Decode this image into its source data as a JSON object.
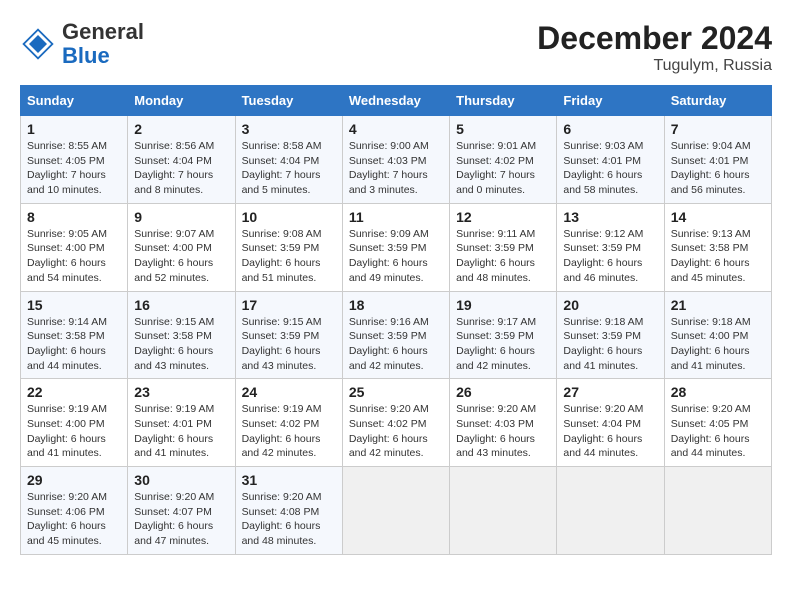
{
  "logo": {
    "text_general": "General",
    "text_blue": "Blue"
  },
  "header": {
    "title": "December 2024",
    "subtitle": "Tugulym, Russia"
  },
  "weekdays": [
    "Sunday",
    "Monday",
    "Tuesday",
    "Wednesday",
    "Thursday",
    "Friday",
    "Saturday"
  ],
  "weeks": [
    [
      {
        "day": "1",
        "info": "Sunrise: 8:55 AM\nSunset: 4:05 PM\nDaylight: 7 hours and 10 minutes."
      },
      {
        "day": "2",
        "info": "Sunrise: 8:56 AM\nSunset: 4:04 PM\nDaylight: 7 hours and 8 minutes."
      },
      {
        "day": "3",
        "info": "Sunrise: 8:58 AM\nSunset: 4:04 PM\nDaylight: 7 hours and 5 minutes."
      },
      {
        "day": "4",
        "info": "Sunrise: 9:00 AM\nSunset: 4:03 PM\nDaylight: 7 hours and 3 minutes."
      },
      {
        "day": "5",
        "info": "Sunrise: 9:01 AM\nSunset: 4:02 PM\nDaylight: 7 hours and 0 minutes."
      },
      {
        "day": "6",
        "info": "Sunrise: 9:03 AM\nSunset: 4:01 PM\nDaylight: 6 hours and 58 minutes."
      },
      {
        "day": "7",
        "info": "Sunrise: 9:04 AM\nSunset: 4:01 PM\nDaylight: 6 hours and 56 minutes."
      }
    ],
    [
      {
        "day": "8",
        "info": "Sunrise: 9:05 AM\nSunset: 4:00 PM\nDaylight: 6 hours and 54 minutes."
      },
      {
        "day": "9",
        "info": "Sunrise: 9:07 AM\nSunset: 4:00 PM\nDaylight: 6 hours and 52 minutes."
      },
      {
        "day": "10",
        "info": "Sunrise: 9:08 AM\nSunset: 3:59 PM\nDaylight: 6 hours and 51 minutes."
      },
      {
        "day": "11",
        "info": "Sunrise: 9:09 AM\nSunset: 3:59 PM\nDaylight: 6 hours and 49 minutes."
      },
      {
        "day": "12",
        "info": "Sunrise: 9:11 AM\nSunset: 3:59 PM\nDaylight: 6 hours and 48 minutes."
      },
      {
        "day": "13",
        "info": "Sunrise: 9:12 AM\nSunset: 3:59 PM\nDaylight: 6 hours and 46 minutes."
      },
      {
        "day": "14",
        "info": "Sunrise: 9:13 AM\nSunset: 3:58 PM\nDaylight: 6 hours and 45 minutes."
      }
    ],
    [
      {
        "day": "15",
        "info": "Sunrise: 9:14 AM\nSunset: 3:58 PM\nDaylight: 6 hours and 44 minutes."
      },
      {
        "day": "16",
        "info": "Sunrise: 9:15 AM\nSunset: 3:58 PM\nDaylight: 6 hours and 43 minutes."
      },
      {
        "day": "17",
        "info": "Sunrise: 9:15 AM\nSunset: 3:59 PM\nDaylight: 6 hours and 43 minutes."
      },
      {
        "day": "18",
        "info": "Sunrise: 9:16 AM\nSunset: 3:59 PM\nDaylight: 6 hours and 42 minutes."
      },
      {
        "day": "19",
        "info": "Sunrise: 9:17 AM\nSunset: 3:59 PM\nDaylight: 6 hours and 42 minutes."
      },
      {
        "day": "20",
        "info": "Sunrise: 9:18 AM\nSunset: 3:59 PM\nDaylight: 6 hours and 41 minutes."
      },
      {
        "day": "21",
        "info": "Sunrise: 9:18 AM\nSunset: 4:00 PM\nDaylight: 6 hours and 41 minutes."
      }
    ],
    [
      {
        "day": "22",
        "info": "Sunrise: 9:19 AM\nSunset: 4:00 PM\nDaylight: 6 hours and 41 minutes."
      },
      {
        "day": "23",
        "info": "Sunrise: 9:19 AM\nSunset: 4:01 PM\nDaylight: 6 hours and 41 minutes."
      },
      {
        "day": "24",
        "info": "Sunrise: 9:19 AM\nSunset: 4:02 PM\nDaylight: 6 hours and 42 minutes."
      },
      {
        "day": "25",
        "info": "Sunrise: 9:20 AM\nSunset: 4:02 PM\nDaylight: 6 hours and 42 minutes."
      },
      {
        "day": "26",
        "info": "Sunrise: 9:20 AM\nSunset: 4:03 PM\nDaylight: 6 hours and 43 minutes."
      },
      {
        "day": "27",
        "info": "Sunrise: 9:20 AM\nSunset: 4:04 PM\nDaylight: 6 hours and 44 minutes."
      },
      {
        "day": "28",
        "info": "Sunrise: 9:20 AM\nSunset: 4:05 PM\nDaylight: 6 hours and 44 minutes."
      }
    ],
    [
      {
        "day": "29",
        "info": "Sunrise: 9:20 AM\nSunset: 4:06 PM\nDaylight: 6 hours and 45 minutes."
      },
      {
        "day": "30",
        "info": "Sunrise: 9:20 AM\nSunset: 4:07 PM\nDaylight: 6 hours and 47 minutes."
      },
      {
        "day": "31",
        "info": "Sunrise: 9:20 AM\nSunset: 4:08 PM\nDaylight: 6 hours and 48 minutes."
      },
      null,
      null,
      null,
      null
    ]
  ]
}
